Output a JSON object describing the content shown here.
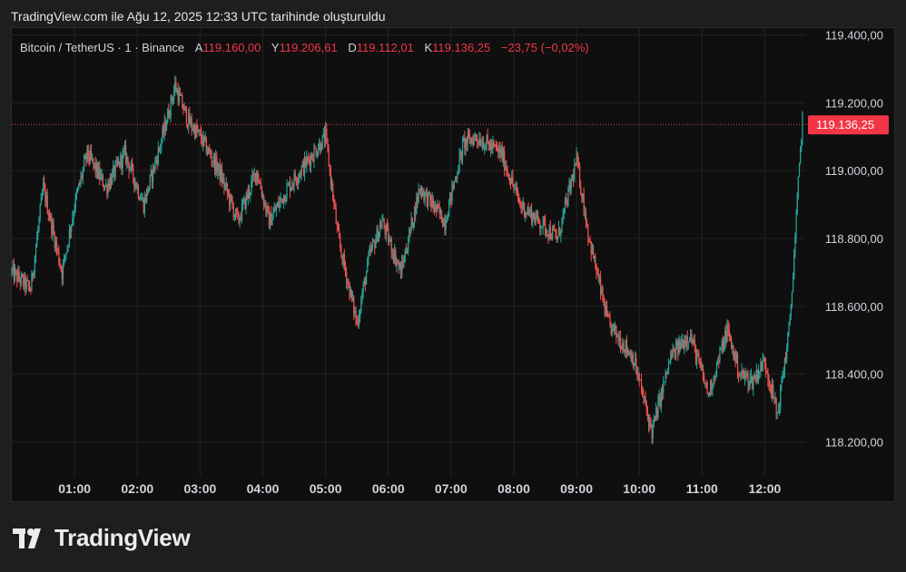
{
  "header": {
    "title": "TradingView.com ile Ağu 12, 2025 12:33 UTC tarihinde oluşturuldu"
  },
  "legend": {
    "symbol": "Bitcoin / TetherUS · 1 · Binance",
    "open_label": "A",
    "open": "119.160,00",
    "high_label": "Y",
    "high": "119.206,61",
    "low_label": "D",
    "low": "119.112,01",
    "close_label": "K",
    "close": "119.136,25",
    "change": "−23,75 (−0,02%)"
  },
  "price_tag": "119.136,25",
  "brand": {
    "name": "TradingView"
  },
  "colors": {
    "up": "#26a69a",
    "down": "#ef5350",
    "tag": "#f23645",
    "grid": "#232323",
    "axis_text": "#d1d4dc"
  },
  "chart_data": {
    "type": "candlestick",
    "title": "Bitcoin / TetherUS · 1 · Binance",
    "x_tick_labels": [
      "01:00",
      "02:00",
      "03:00",
      "04:00",
      "05:00",
      "06:00",
      "07:00",
      "08:00",
      "09:00",
      "10:00",
      "11:00",
      "12:00"
    ],
    "x_tick_hours": [
      1,
      2,
      3,
      4,
      5,
      6,
      7,
      8,
      9,
      10,
      11,
      12
    ],
    "x_range_hours": [
      0.0,
      12.5
    ],
    "y_tick_labels": [
      "119.400,00",
      "119.200,00",
      "119.000,00",
      "118.800,00",
      "118.600,00",
      "118.400,00",
      "118.200,00"
    ],
    "y_ticks": [
      119400,
      119200,
      119000,
      118800,
      118600,
      118400,
      118200
    ],
    "ylim": [
      118100,
      119420
    ],
    "last_price": 119136.25,
    "grid": true,
    "path_hours": [
      0.0,
      0.3,
      0.5,
      0.8,
      1.0,
      1.2,
      1.5,
      1.8,
      2.1,
      2.4,
      2.6,
      2.8,
      3.0,
      3.3,
      3.6,
      3.9,
      4.1,
      4.4,
      4.8,
      5.0,
      5.2,
      5.5,
      5.7,
      5.9,
      6.2,
      6.5,
      6.9,
      7.2,
      7.4,
      7.8,
      8.1,
      8.4,
      8.7,
      9.0,
      9.2,
      9.5,
      9.9,
      10.2,
      10.5,
      10.8,
      11.1,
      11.4,
      11.6,
      11.8,
      12.0,
      12.2,
      12.4,
      12.6
    ],
    "path_prices": [
      118700,
      118650,
      118950,
      118700,
      118900,
      119050,
      118950,
      119050,
      118900,
      119100,
      119250,
      119150,
      119100,
      119000,
      118850,
      119000,
      118850,
      118950,
      119050,
      119100,
      118800,
      118550,
      118750,
      118850,
      118700,
      118950,
      118850,
      119080,
      119100,
      119050,
      118900,
      118850,
      118800,
      119030,
      118800,
      118550,
      118450,
      118230,
      118450,
      118520,
      118340,
      118530,
      118400,
      118380,
      118440,
      118280,
      118550,
      119160
    ]
  }
}
